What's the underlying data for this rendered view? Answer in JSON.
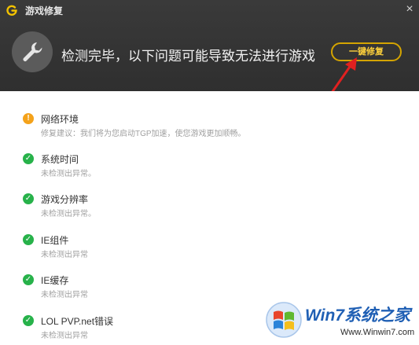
{
  "window": {
    "title": "游戏修复",
    "close_glyph": "×",
    "logo_icon": "tgp-logo-icon"
  },
  "banner": {
    "icon": "wrench-icon",
    "headline": "检测完毕，以下问题可能导致无法进行游戏",
    "repair_button": "一键修复",
    "annotation": "red-arrow-pointing-to-repair-button"
  },
  "results": [
    {
      "status": "warning",
      "icon_glyph": "!",
      "title": "网络环境",
      "desc": "修复建议：我们将为您启动TGP加速，使您游戏更加顺畅。"
    },
    {
      "status": "ok",
      "icon_glyph": "✓",
      "title": "系统时间",
      "desc": "未检测出异常。"
    },
    {
      "status": "ok",
      "icon_glyph": "✓",
      "title": "游戏分辨率",
      "desc": "未检测出异常。"
    },
    {
      "status": "ok",
      "icon_glyph": "✓",
      "title": "IE组件",
      "desc": "未检测出异常"
    },
    {
      "status": "ok",
      "icon_glyph": "✓",
      "title": "IE缓存",
      "desc": "未检测出异常"
    },
    {
      "status": "ok",
      "icon_glyph": "✓",
      "title": "LOL PVP.net错误",
      "desc": "未检测出异常"
    }
  ],
  "watermark": {
    "brand": "Win7系统之家",
    "url": "Www.Winwin7.com"
  },
  "colors": {
    "header_bg": "#333333",
    "accent_gold": "#d4a400",
    "warning": "#f4a21a",
    "ok": "#27b24a",
    "arrow": "#e02020"
  }
}
